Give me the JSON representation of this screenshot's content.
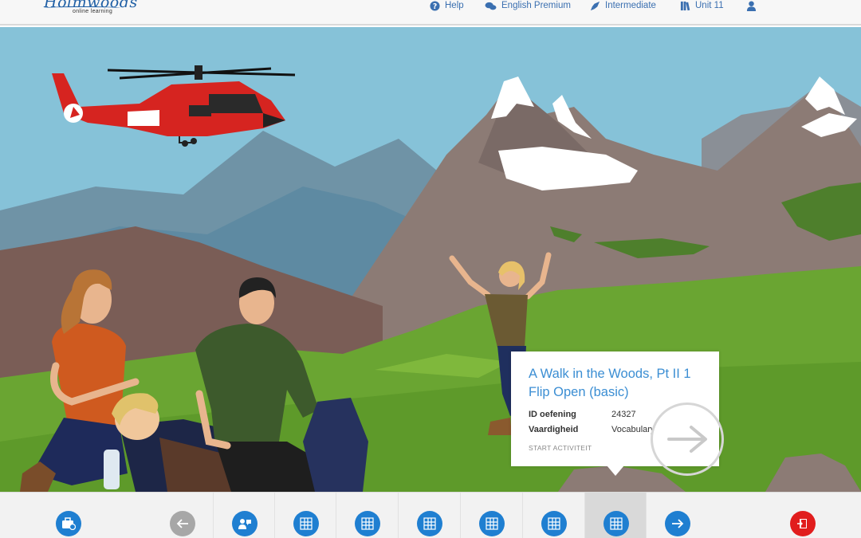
{
  "header": {
    "logo_text": "Holmwoods",
    "logo_subtitle": "online learning",
    "nav": [
      {
        "label": "Help",
        "icon": "help-icon"
      },
      {
        "label": "English Premium",
        "icon": "chat-bubbles-icon"
      },
      {
        "label": "Intermediate",
        "icon": "rocket-icon"
      },
      {
        "label": "Unit 11",
        "icon": "books-icon"
      },
      {
        "label": "",
        "icon": "user-icon"
      }
    ]
  },
  "card": {
    "title_line1": "A Walk in the Woods, Pt II 1",
    "title_line2": "Flip Open (basic)",
    "rows": [
      {
        "label": "ID oefening",
        "value": "24327"
      },
      {
        "label": "Vaardigheid",
        "value": "Vocabulary"
      }
    ],
    "start_label": "START ACTIVITEIT",
    "next_icon": "arrow-right-icon"
  },
  "toolbar": {
    "buttons": [
      {
        "icon": "toolbox-icon",
        "color": "#1f7fd1"
      },
      {
        "icon": "arrow-left-icon",
        "color": "#a7a7a7"
      },
      {
        "icon": "person-speech-icon",
        "color": "#1f7fd1"
      },
      {
        "icon": "grid-icon",
        "color": "#1f7fd1"
      },
      {
        "icon": "grid-icon",
        "color": "#1f7fd1"
      },
      {
        "icon": "grid-icon",
        "color": "#1f7fd1"
      },
      {
        "icon": "grid-icon",
        "color": "#1f7fd1"
      },
      {
        "icon": "grid-icon",
        "color": "#1f7fd1"
      },
      {
        "icon": "grid-icon",
        "color": "#1f7fd1",
        "active": true
      },
      {
        "icon": "arrow-right-icon",
        "color": "#1f7fd1"
      },
      {
        "icon": "exit-door-icon",
        "color": "#e11d1d"
      }
    ]
  },
  "colors": {
    "accent": "#1f7fd1",
    "title_blue": "#3b8ed3",
    "exit_red": "#e11d1d",
    "sky": "#86c2d8",
    "grass": "#5e9a2a"
  }
}
